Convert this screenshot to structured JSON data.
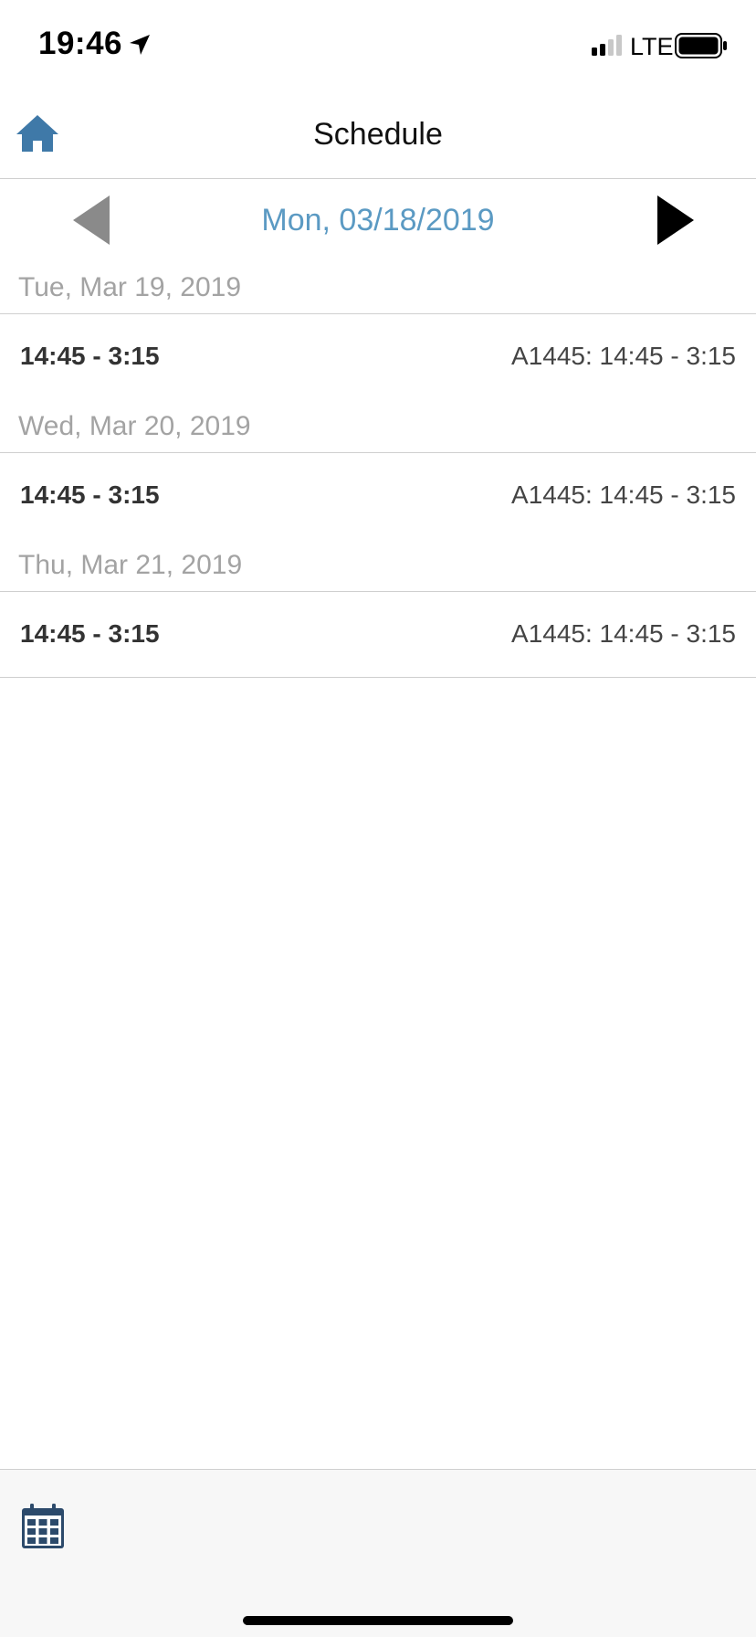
{
  "status_bar": {
    "time": "19:46",
    "network": "LTE",
    "icons": [
      "location-arrow-icon",
      "signal-icon",
      "battery-icon"
    ]
  },
  "nav": {
    "title": "Schedule",
    "home_icon": "home-icon"
  },
  "date_navigator": {
    "current_date": "Mon, 03/18/2019",
    "prev_icon": "triangle-left-icon",
    "next_icon": "triangle-right-icon"
  },
  "schedule": {
    "days": [
      {
        "header": "Tue, Mar 19, 2019",
        "shift_time": "14:45 - 3:15",
        "shift_detail": "A1445: 14:45 - 3:15"
      },
      {
        "header": "Wed, Mar 20, 2019",
        "shift_time": "14:45 - 3:15",
        "shift_detail": "A1445: 14:45 - 3:15"
      },
      {
        "header": "Thu, Mar 21, 2019",
        "shift_time": "14:45 - 3:15",
        "shift_detail": "A1445: 14:45 - 3:15"
      }
    ]
  },
  "tab_bar": {
    "icons": [
      "calendar-icon"
    ]
  },
  "colors": {
    "accent": "#5b9ac3",
    "home_icon": "#3f79a8",
    "calendar_icon": "#2c4a6b",
    "header_text": "#a3a3a3",
    "divider": "#cfcfcf"
  }
}
